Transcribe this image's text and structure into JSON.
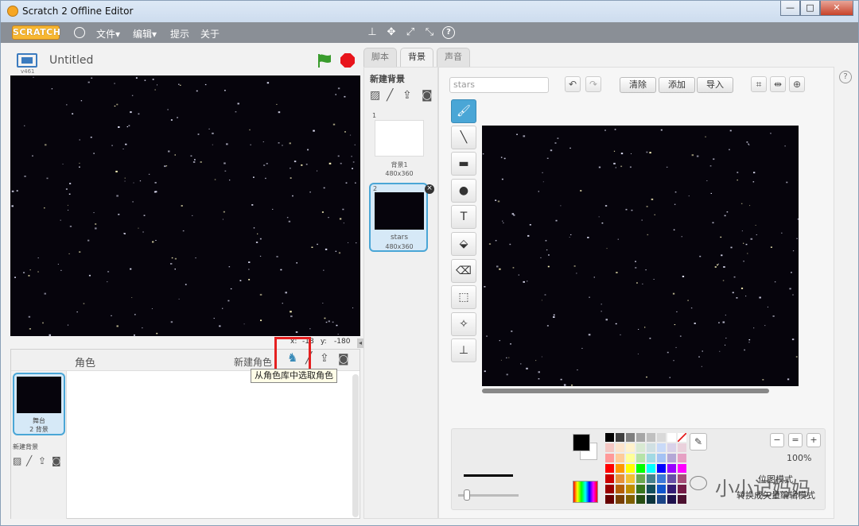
{
  "window": {
    "title": "Scratch 2 Offline Editor",
    "min": "—",
    "max": "□",
    "close": "✕"
  },
  "menu": {
    "logo": "SCRATCH",
    "file": "文件▾",
    "edit": "编辑▾",
    "tips": "提示",
    "about": "关于"
  },
  "toolbar_icons": [
    "stamp-icon",
    "cut-icon",
    "grow-icon",
    "shrink-icon",
    "help-icon"
  ],
  "stage": {
    "title": "Untitled",
    "version": "v461",
    "x_label": "x:",
    "x_value": "-18",
    "y_label": "y:",
    "y_value": "-180",
    "collapse": "◂"
  },
  "sprites": {
    "header": "角色",
    "new_sprite_label": "新建角色",
    "tooltip": "从角色库中选取角色",
    "stage_thumb_title": "舞台",
    "stage_thumb_sub": "2 背景",
    "new_backdrop_label": "新建背景"
  },
  "tabs": [
    {
      "label": "脚本"
    },
    {
      "label": "背景"
    },
    {
      "label": "声音"
    }
  ],
  "costumes": {
    "new_label": "新建背景",
    "items": [
      {
        "num": "1",
        "name": "背景1",
        "size": "480x360"
      },
      {
        "num": "2",
        "name": "stars",
        "size": "480x360"
      }
    ],
    "delete": "×"
  },
  "paint": {
    "name_value": "stars",
    "undo": "↶",
    "redo": "↷",
    "clear": "清除",
    "add": "添加",
    "import": "导入",
    "tools": [
      {
        "name": "brush-tool",
        "glyph": "🖌",
        "selected": true
      },
      {
        "name": "line-tool",
        "glyph": "╲",
        "selected": false
      },
      {
        "name": "rectangle-tool",
        "glyph": "▬",
        "selected": false
      },
      {
        "name": "ellipse-tool",
        "glyph": "●",
        "selected": false
      },
      {
        "name": "text-tool",
        "glyph": "T",
        "selected": false
      },
      {
        "name": "fill-tool",
        "glyph": "⬙",
        "selected": false
      },
      {
        "name": "eraser-tool",
        "glyph": "⌫",
        "selected": false
      },
      {
        "name": "select-tool",
        "glyph": "⬚",
        "selected": false
      },
      {
        "name": "select-clone-tool",
        "glyph": "✧",
        "selected": false
      },
      {
        "name": "stamp-tool",
        "glyph": "⊥",
        "selected": false
      }
    ],
    "zoom": "100%",
    "zoom_out": "−",
    "zoom_reset": "=",
    "zoom_in": "+",
    "mode_label": "位图模式",
    "convert_label": "转换成矢量编辑模式"
  },
  "watermark": "小小记妈妈",
  "colors": {
    "accent": "#4aa6d6",
    "stage_bg": "#06040c",
    "stop": "#e8141b",
    "flag": "#3a9c2d",
    "highlight_box": "#e52020",
    "palette": [
      [
        "#000000",
        "#404040",
        "#7f7f7f",
        "#a6a6a6",
        "#c0c0c0",
        "#d9d9d9",
        "#ffffff",
        "none"
      ],
      [
        "#f4c7c3",
        "#fce4cc",
        "#fff2cc",
        "#d9ead3",
        "#d0e0e3",
        "#c9daf8",
        "#d9d2e9",
        "#ead1dc"
      ],
      [
        "#ff9999",
        "#ffcc99",
        "#ffff99",
        "#b6e3a8",
        "#a2d9e3",
        "#a4c2f4",
        "#b4a7d6",
        "#e6a0c4"
      ],
      [
        "#ff0000",
        "#ff9900",
        "#ffff00",
        "#00ff00",
        "#00ffff",
        "#0000ff",
        "#9900ff",
        "#ff00ff"
      ],
      [
        "#cc0000",
        "#e69138",
        "#f1c232",
        "#6aa84f",
        "#45818e",
        "#3c78d8",
        "#674ea7",
        "#a64d79"
      ],
      [
        "#990000",
        "#b45f06",
        "#bf9000",
        "#38761d",
        "#134f5c",
        "#1155cc",
        "#351c75",
        "#741b47"
      ],
      [
        "#660000",
        "#783f04",
        "#7f6000",
        "#274e13",
        "#0c343d",
        "#1c4587",
        "#20124d",
        "#4c1130"
      ]
    ]
  }
}
